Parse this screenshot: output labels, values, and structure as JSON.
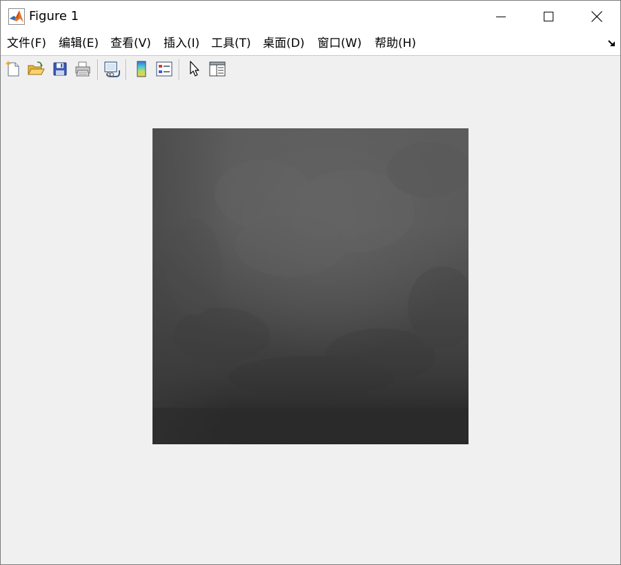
{
  "window": {
    "title": "Figure 1",
    "app_icon": "matlab-logo-icon",
    "controls": {
      "minimize": "minimize-icon",
      "maximize": "maximize-icon",
      "close": "close-icon"
    }
  },
  "menubar": {
    "items": [
      {
        "label": "文件(F)"
      },
      {
        "label": "编辑(E)"
      },
      {
        "label": "查看(V)"
      },
      {
        "label": "插入(I)"
      },
      {
        "label": "工具(T)"
      },
      {
        "label": "桌面(D)"
      },
      {
        "label": "窗口(W)"
      },
      {
        "label": "帮助(H)"
      }
    ],
    "dock_icon": "dock-arrow-icon"
  },
  "toolbar": {
    "buttons": [
      {
        "icon": "new-figure-icon"
      },
      {
        "icon": "open-file-icon"
      },
      {
        "icon": "save-icon"
      },
      {
        "icon": "print-icon"
      },
      {
        "icon": "link-plot-icon"
      },
      {
        "icon": "insert-colorbar-icon"
      },
      {
        "icon": "insert-legend-icon"
      },
      {
        "icon": "edit-plot-pointer-icon"
      },
      {
        "icon": "open-property-inspector-icon"
      }
    ]
  },
  "figure": {
    "content": "grayscale-image",
    "colors": {
      "image_top": "#5e5e5e",
      "image_middle": "#4a4a4a",
      "image_bottom": "#2a2a2a",
      "background": "#f0f0f0"
    }
  }
}
